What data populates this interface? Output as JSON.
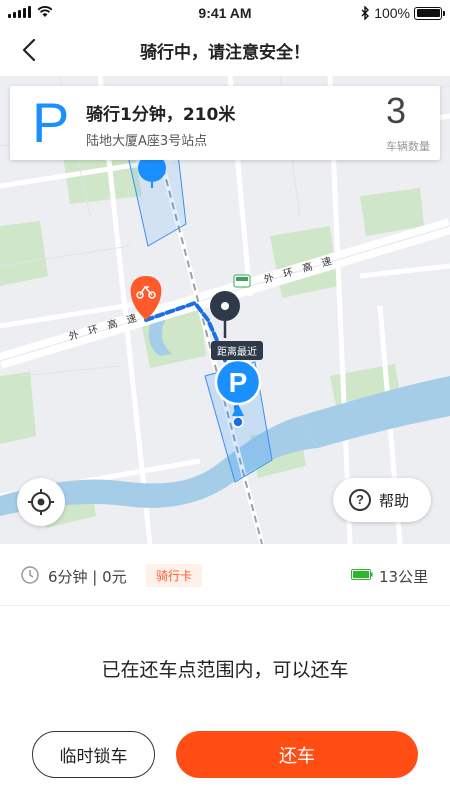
{
  "status_bar": {
    "time": "9:41 AM",
    "battery": "100%"
  },
  "nav": {
    "title": "骑行中，请注意安全！"
  },
  "parking_card": {
    "icon_letter": "P",
    "title": "骑行1分钟，210米",
    "location": "陆地大厦A座3号站点",
    "vehicle_count": "3",
    "vehicle_count_label": "车辆数量"
  },
  "map": {
    "road_label": "外环高速",
    "nearest_tag": "距离最近",
    "marker_letter": "P",
    "highway_shield": "S20"
  },
  "help": {
    "label": "帮助"
  },
  "ride_info": {
    "duration_cost": "6分钟 | 0元",
    "card_badge": "骑行卡",
    "battery_range": "13公里"
  },
  "notice": "已在还车点范围内，可以还车",
  "actions": {
    "temp_lock": "临时锁车",
    "return": "还车"
  },
  "colors": {
    "primary": "#ff4d14",
    "parking_blue": "#1a8fff",
    "battery_green": "#2db52d"
  }
}
